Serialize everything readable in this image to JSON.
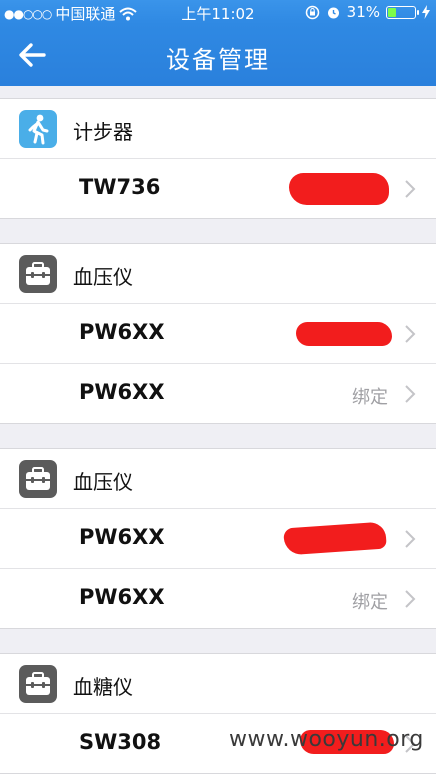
{
  "status_bar": {
    "signal_dots": "●●○○○",
    "carrier": "中国联通",
    "wifi_icon": "wifi-icon",
    "time": "上午11:02",
    "battery_percent": "31%",
    "battery_level": 0.31
  },
  "nav": {
    "back_icon": "back-arrow-icon",
    "title": "设备管理"
  },
  "groups": [
    {
      "icon": "pedometer-icon",
      "label": "计步器",
      "devices": [
        {
          "name": "TW736",
          "status": ""
        }
      ]
    },
    {
      "icon": "toolbox-icon",
      "label": "血压仪",
      "devices": [
        {
          "name": "PW6XX",
          "status": ""
        },
        {
          "name": "PW6XX",
          "status": "绑定"
        }
      ]
    },
    {
      "icon": "toolbox-icon",
      "label": "血压仪",
      "devices": [
        {
          "name": "PW6XX",
          "status": ""
        },
        {
          "name": "PW6XX",
          "status": "绑定"
        }
      ]
    },
    {
      "icon": "toolbox-icon",
      "label": "血糖仪",
      "devices": [
        {
          "name": "SW308",
          "status": ""
        }
      ]
    }
  ],
  "watermark": "www.wooyun.org",
  "colors": {
    "nav_blue": "#2f89e3",
    "redaction": "#f21d1d",
    "battery_green": "#7cfc4b"
  }
}
